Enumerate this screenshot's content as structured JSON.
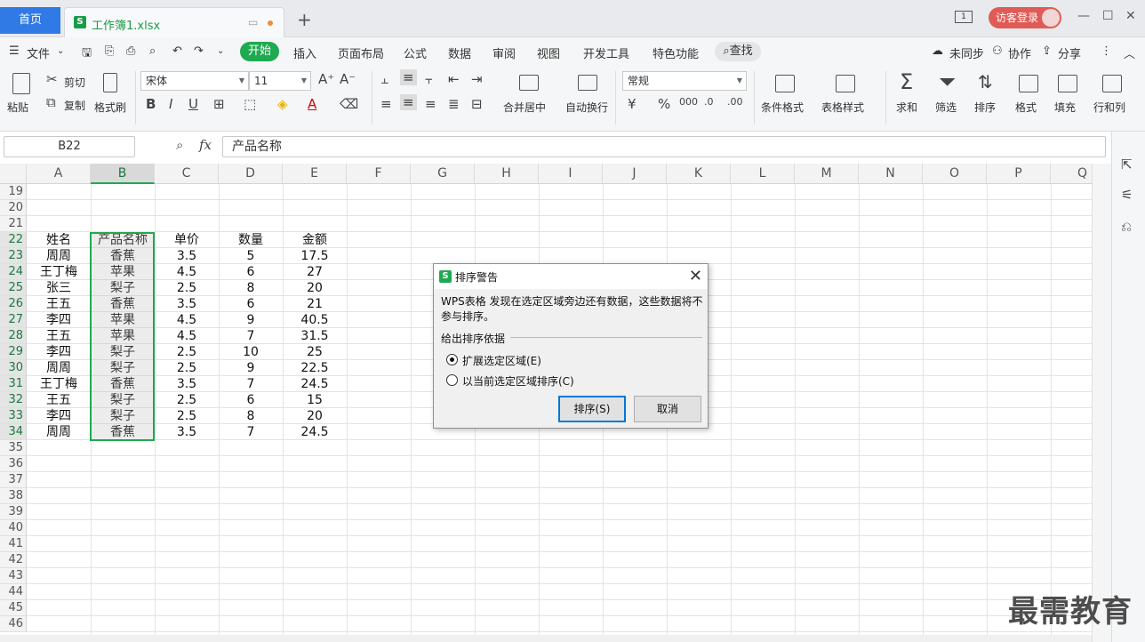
{
  "titlebar": {
    "home_tab": "首页",
    "file_tab": "工作簿1.xlsx",
    "new_tab": "+",
    "page_indicator": "1",
    "login": "访客登录"
  },
  "menu": {
    "file": "文件",
    "items": [
      "开始",
      "插入",
      "页面布局",
      "公式",
      "数据",
      "审阅",
      "视图",
      "开发工具",
      "特色功能"
    ],
    "search": "查找",
    "right": [
      "未同步",
      "协作",
      "分享"
    ]
  },
  "ribbon": {
    "paste": "粘贴",
    "cut": "剪切",
    "copy": "复制",
    "format_painter": "格式刷",
    "font_name": "宋体",
    "font_size": "11",
    "merge_center": "合并居中",
    "wrap_text": "自动换行",
    "number_format": "常规",
    "cond_format": "条件格式",
    "table_style": "表格样式",
    "sum": "求和",
    "filter": "筛选",
    "sort": "排序",
    "format": "格式",
    "fill": "填充",
    "rowcol": "行和列"
  },
  "formula_bar": {
    "name_box": "B22",
    "fx": "fx",
    "value": "产品名称"
  },
  "columns": [
    "A",
    "B",
    "C",
    "D",
    "E",
    "F",
    "G",
    "H",
    "I",
    "J",
    "K",
    "L",
    "M",
    "N",
    "O",
    "P",
    "Q"
  ],
  "rows": [
    "19",
    "20",
    "21",
    "22",
    "23",
    "24",
    "25",
    "26",
    "27",
    "28",
    "29",
    "30",
    "31",
    "32",
    "33",
    "34",
    "35",
    "36",
    "37",
    "38",
    "39",
    "40",
    "41",
    "42",
    "43",
    "44",
    "45",
    "46"
  ],
  "table": {
    "header": [
      "姓名",
      "产品名称",
      "单价",
      "数量",
      "金额"
    ],
    "data": [
      [
        "周周",
        "香蕉",
        "3.5",
        "5",
        "17.5"
      ],
      [
        "王丁梅",
        "苹果",
        "4.5",
        "6",
        "27"
      ],
      [
        "张三",
        "梨子",
        "2.5",
        "8",
        "20"
      ],
      [
        "王五",
        "香蕉",
        "3.5",
        "6",
        "21"
      ],
      [
        "李四",
        "苹果",
        "4.5",
        "9",
        "40.5"
      ],
      [
        "王五",
        "苹果",
        "4.5",
        "7",
        "31.5"
      ],
      [
        "李四",
        "梨子",
        "2.5",
        "10",
        "25"
      ],
      [
        "周周",
        "梨子",
        "2.5",
        "9",
        "22.5"
      ],
      [
        "王丁梅",
        "香蕉",
        "3.5",
        "7",
        "24.5"
      ],
      [
        "王五",
        "梨子",
        "2.5",
        "6",
        "15"
      ],
      [
        "李四",
        "梨子",
        "2.5",
        "8",
        "20"
      ],
      [
        "周周",
        "香蕉",
        "3.5",
        "7",
        "24.5"
      ]
    ]
  },
  "dialog": {
    "title": "排序警告",
    "message": "WPS表格 发现在选定区域旁边还有数据，这些数据将不参与排序。",
    "group": "给出排序依据",
    "option1": "扩展选定区域(E)",
    "option2": "以当前选定区域排序(C)",
    "ok": "排序(S)",
    "cancel": "取消"
  },
  "watermark": "最需教育",
  "colors": {
    "accent": "#1fa951",
    "home_tab": "#2f7ae5",
    "login": "#e05b55"
  }
}
